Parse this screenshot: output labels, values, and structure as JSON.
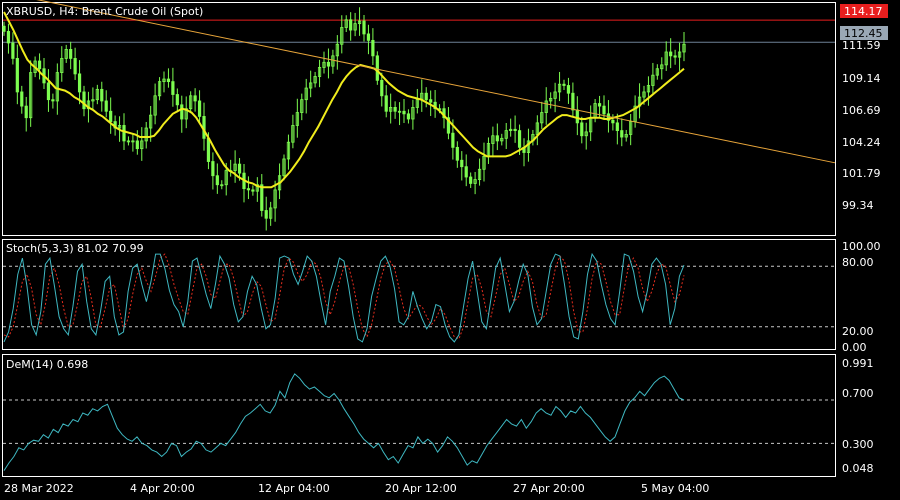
{
  "chart_data": [
    {
      "type": "candlestick",
      "title": "XBRUSD, H4:  Brent Crude Oil (Spot)",
      "ylim": [
        97.5,
        115.5
      ],
      "y_ticks": [
        "111.59",
        "109.14",
        "106.69",
        "104.24",
        "101.79",
        "99.34"
      ],
      "price_tags": [
        {
          "value": "114.17",
          "bg": "#e81e1e",
          "fg": "#ffffff"
        },
        {
          "value": "112.45",
          "bg": "#9aa8b5",
          "fg": "#000000"
        }
      ],
      "x_labels": [
        "28 Mar 2022",
        "4 Apr 20:00",
        "12 Apr 04:00",
        "20 Apr 12:00",
        "27 Apr 20:00",
        "5 May 04:00"
      ],
      "series": [
        {
          "name": "close",
          "values": [
            113.3,
            112.4,
            111.2,
            108.6,
            107.5,
            106.6,
            110.1,
            111.0,
            110.4,
            109.3,
            108.0,
            107.9,
            110.1,
            111.2,
            111.9,
            111.2,
            110.0,
            108.6,
            107.3,
            107.9,
            108.0,
            108.8,
            107.9,
            107.1,
            106.3,
            105.8,
            106.0,
            104.8,
            104.8,
            104.8,
            104.2,
            104.8,
            105.8,
            106.8,
            108.3,
            109.4,
            109.6,
            109.4,
            108.4,
            107.6,
            106.5,
            107.3,
            108.3,
            107.9,
            106.7,
            105.0,
            103.2,
            102.1,
            101.4,
            101.4,
            102.5,
            102.5,
            103.0,
            102.3,
            101.1,
            101.0,
            100.9,
            101.4,
            99.4,
            98.8,
            99.6,
            101.0,
            102.1,
            103.4,
            104.7,
            106.0,
            107.0,
            108.0,
            108.9,
            109.3,
            109.8,
            110.5,
            110.9,
            110.6,
            111.4,
            112.3,
            113.6,
            114.2,
            113.4,
            113.9,
            114.1,
            113.1,
            112.6,
            111.4,
            109.5,
            108.3,
            107.1,
            107.4,
            107.1,
            107.1,
            106.9,
            106.5,
            107.4,
            108.0,
            108.5,
            108.0,
            107.8,
            107.3,
            107.3,
            106.6,
            105.4,
            104.3,
            103.3,
            102.8,
            102.0,
            101.5,
            101.8,
            102.6,
            103.6,
            104.6,
            105.2,
            104.8,
            105.0,
            105.6,
            105.7,
            105.6,
            104.3,
            103.9,
            104.8,
            105.3,
            106.2,
            107.0,
            107.9,
            108.1,
            108.6,
            109.2,
            109.1,
            108.5,
            107.2,
            106.2,
            105.2,
            105.5,
            106.6,
            107.7,
            107.5,
            106.9,
            106.4,
            106.2,
            105.6,
            105.1,
            105.3,
            106.3,
            107.5,
            108.2,
            108.6,
            109.1,
            109.9,
            110.4,
            110.7,
            111.7,
            111.4,
            111.3,
            111.7,
            112.3
          ]
        },
        {
          "name": "moving average",
          "values": [
            114.8,
            114.1,
            113.4,
            112.6,
            111.8,
            111.1,
            110.7,
            110.4,
            110.0,
            109.7,
            109.3,
            108.9,
            108.8,
            108.7,
            108.5,
            108.2,
            108.0,
            107.7,
            107.4,
            107.2,
            106.9,
            106.7,
            106.4,
            106.1,
            105.8,
            105.6,
            105.5,
            105.4,
            105.3,
            105.1,
            105.1,
            105.1,
            105.2,
            105.6,
            106.1,
            106.5,
            106.9,
            107.1,
            107.3,
            107.2,
            107.0,
            106.6,
            106.0,
            105.4,
            104.8,
            104.1,
            103.5,
            102.9,
            102.5,
            102.3,
            102.0,
            101.8,
            101.6,
            101.5,
            101.3,
            101.2,
            101.2,
            101.2,
            101.4,
            101.6,
            102.0,
            102.4,
            102.9,
            103.4,
            104.0,
            104.7,
            105.3,
            105.9,
            106.6,
            107.3,
            108.0,
            108.6,
            109.3,
            109.8,
            110.2,
            110.5,
            110.7,
            110.6,
            110.5,
            110.4,
            110.1,
            109.7,
            109.3,
            109.0,
            108.7,
            108.5,
            108.3,
            108.2,
            108.1,
            108.0,
            107.8,
            107.6,
            107.4,
            107.1,
            106.7,
            106.3,
            105.9,
            105.5,
            105.1,
            104.7,
            104.3,
            104.0,
            103.8,
            103.6,
            103.6,
            103.6,
            103.6,
            103.6,
            103.7,
            103.9,
            104.1,
            104.3,
            104.6,
            104.9,
            105.3,
            105.7,
            106.0,
            106.3,
            106.6,
            106.8,
            106.8,
            106.7,
            106.6,
            106.5,
            106.5,
            106.6,
            106.6,
            106.6,
            106.5,
            106.5,
            106.6,
            106.7,
            106.8,
            107.0,
            107.2,
            107.4,
            107.7,
            108.0,
            108.3,
            108.6,
            108.9,
            109.2,
            109.5,
            109.8,
            110.1,
            110.4
          ]
        },
        {
          "name": "trendline",
          "x": [
            0,
            1
          ],
          "values": [
            116.3,
            103.1
          ]
        }
      ],
      "colors": {
        "up_down": "#7dfc50",
        "ma": "#f0ec1c",
        "trendline": "#e8a53a",
        "price_line_top": "#e81e1e",
        "price_line_mid": "#6e8196"
      }
    },
    {
      "type": "line",
      "title": "Stoch(5,3,3) 81.02 70.99",
      "ylim": [
        0,
        100
      ],
      "y_ticks": [
        "100.00",
        "80.00",
        "20.00",
        "0.00"
      ],
      "levels": [
        80,
        20
      ],
      "series": [
        {
          "name": "main",
          "values": [
            5,
            15,
            38,
            72,
            88,
            60,
            22,
            12,
            35,
            82,
            88,
            60,
            30,
            18,
            12,
            40,
            75,
            82,
            45,
            18,
            12,
            35,
            65,
            70,
            30,
            12,
            15,
            55,
            78,
            82,
            62,
            45,
            65,
            92,
            92,
            78,
            56,
            42,
            35,
            20,
            45,
            85,
            88,
            70,
            52,
            38,
            62,
            90,
            82,
            68,
            42,
            25,
            30,
            55,
            70,
            62,
            38,
            18,
            22,
            48,
            88,
            90,
            88,
            72,
            62,
            75,
            90,
            85,
            70,
            45,
            22,
            55,
            70,
            88,
            85,
            60,
            30,
            8,
            5,
            18,
            50,
            68,
            85,
            90,
            80,
            58,
            25,
            22,
            30,
            55,
            40,
            28,
            18,
            25,
            42,
            40,
            22,
            10,
            5,
            12,
            40,
            68,
            85,
            55,
            25,
            18,
            48,
            78,
            88,
            62,
            35,
            45,
            65,
            82,
            72,
            40,
            22,
            28,
            55,
            82,
            92,
            90,
            62,
            30,
            10,
            8,
            35,
            72,
            92,
            85,
            62,
            42,
            28,
            22,
            55,
            92,
            90,
            75,
            50,
            35,
            55,
            82,
            88,
            82,
            62,
            22,
            38,
            70,
            81
          ]
        },
        {
          "name": "signal",
          "values": [
            12,
            10,
            20,
            42,
            65,
            72,
            58,
            32,
            22,
            42,
            70,
            78,
            62,
            38,
            20,
            22,
            42,
            65,
            70,
            48,
            22,
            20,
            38,
            58,
            62,
            40,
            18,
            28,
            52,
            72,
            78,
            65,
            55,
            70,
            88,
            92,
            80,
            62,
            48,
            35,
            32,
            55,
            78,
            82,
            70,
            52,
            48,
            65,
            82,
            82,
            68,
            48,
            30,
            35,
            52,
            65,
            60,
            42,
            25,
            28,
            52,
            78,
            88,
            84,
            72,
            65,
            72,
            85,
            82,
            68,
            45,
            32,
            45,
            65,
            80,
            80,
            62,
            38,
            18,
            10,
            22,
            45,
            68,
            82,
            85,
            78,
            58,
            38,
            28,
            35,
            42,
            40,
            30,
            22,
            28,
            38,
            32,
            20,
            10,
            8,
            20,
            45,
            68,
            72,
            58,
            35,
            30,
            50,
            72,
            78,
            62,
            45,
            50,
            65,
            75,
            65,
            42,
            28,
            32,
            55,
            78,
            90,
            85,
            65,
            35,
            15,
            15,
            38,
            68,
            85,
            82,
            65,
            45,
            32,
            32,
            58,
            82,
            88,
            78,
            58,
            45,
            55,
            72,
            82,
            80,
            62,
            45,
            52,
            71
          ]
        }
      ],
      "colors": {
        "main": "#3fb8c2",
        "signal": "#e62e1e"
      }
    },
    {
      "type": "line",
      "title": "DeM(14) 0.698",
      "ylim": [
        0.0,
        1.05
      ],
      "y_ticks": [
        "0.991",
        "0.700",
        "0.300",
        "0.048"
      ],
      "levels": [
        0.7,
        0.3
      ],
      "series": [
        {
          "name": "DeMarker",
          "values": [
            0.05,
            0.12,
            0.18,
            0.26,
            0.24,
            0.3,
            0.33,
            0.32,
            0.38,
            0.35,
            0.43,
            0.4,
            0.48,
            0.46,
            0.52,
            0.5,
            0.58,
            0.56,
            0.62,
            0.6,
            0.64,
            0.66,
            0.55,
            0.44,
            0.38,
            0.34,
            0.32,
            0.36,
            0.3,
            0.28,
            0.24,
            0.22,
            0.18,
            0.22,
            0.3,
            0.28,
            0.18,
            0.22,
            0.25,
            0.32,
            0.3,
            0.24,
            0.22,
            0.26,
            0.3,
            0.28,
            0.34,
            0.4,
            0.48,
            0.55,
            0.58,
            0.62,
            0.66,
            0.6,
            0.58,
            0.65,
            0.78,
            0.72,
            0.86,
            0.94,
            0.9,
            0.84,
            0.8,
            0.82,
            0.78,
            0.74,
            0.72,
            0.76,
            0.7,
            0.62,
            0.55,
            0.48,
            0.4,
            0.34,
            0.3,
            0.26,
            0.3,
            0.22,
            0.15,
            0.18,
            0.12,
            0.2,
            0.28,
            0.26,
            0.36,
            0.3,
            0.34,
            0.3,
            0.22,
            0.28,
            0.36,
            0.32,
            0.26,
            0.18,
            0.1,
            0.14,
            0.12,
            0.2,
            0.28,
            0.34,
            0.4,
            0.46,
            0.52,
            0.48,
            0.46,
            0.52,
            0.44,
            0.5,
            0.58,
            0.62,
            0.58,
            0.56,
            0.64,
            0.6,
            0.54,
            0.6,
            0.58,
            0.64,
            0.58,
            0.54,
            0.48,
            0.42,
            0.36,
            0.32,
            0.36,
            0.48,
            0.6,
            0.68,
            0.72,
            0.78,
            0.74,
            0.8,
            0.86,
            0.9,
            0.92,
            0.88,
            0.8,
            0.72,
            0.7
          ]
        }
      ],
      "colors": {
        "line": "#3fb8c2"
      }
    }
  ]
}
